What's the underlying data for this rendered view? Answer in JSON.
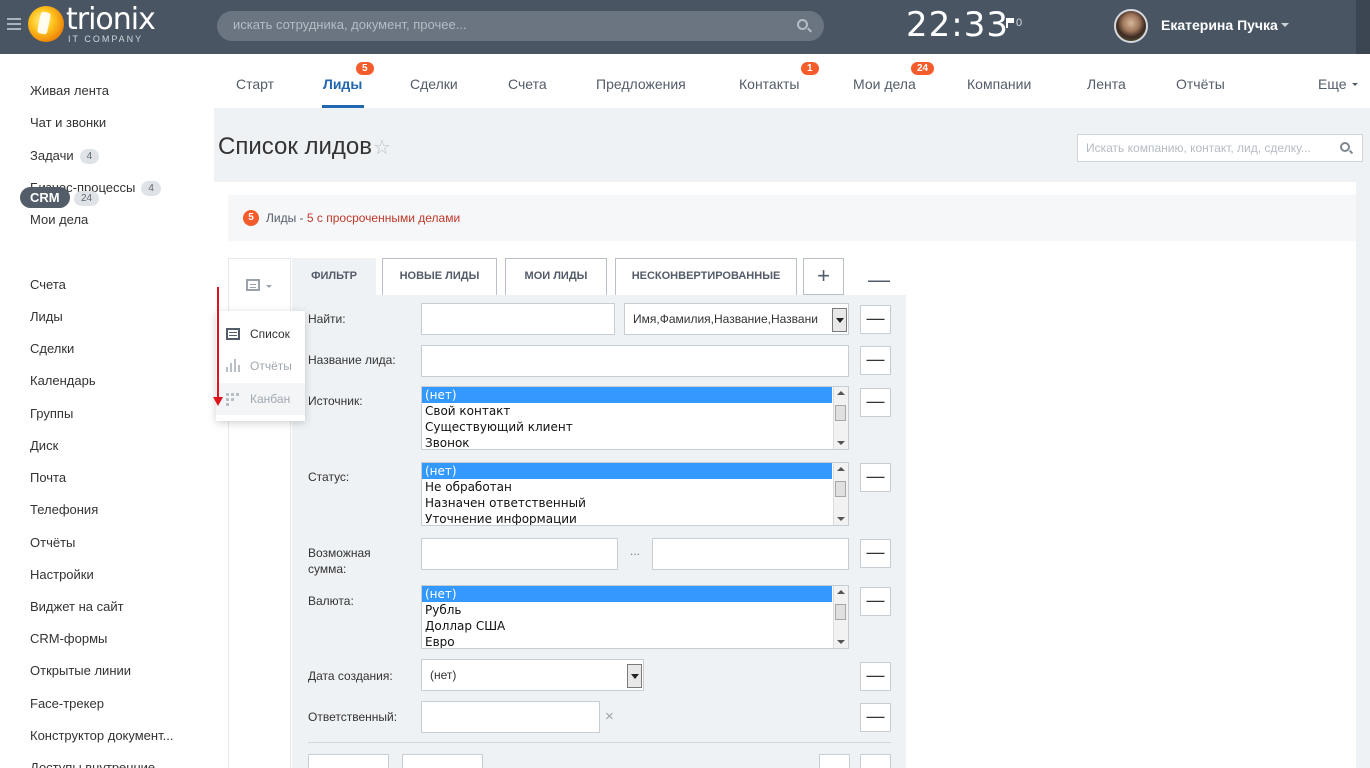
{
  "header": {
    "logo_text": "trionix",
    "logo_sub": "IT COMPANY",
    "search_placeholder": "искать сотрудника, документ, прочее...",
    "clock": "22:33",
    "flag_count": "0",
    "user_name": "Екатерина Пучка"
  },
  "left_menu": [
    {
      "label": "Живая лента"
    },
    {
      "label": "Чат и звонки"
    },
    {
      "label": "Задачи",
      "badge": "4"
    },
    {
      "label": "Бизнес-процессы",
      "badge": "4"
    },
    {
      "label": "Мои дела"
    },
    {
      "label": "CRM",
      "badge": "24"
    },
    {
      "label": "Счета"
    },
    {
      "label": "Лиды"
    },
    {
      "label": "Сделки"
    },
    {
      "label": "Календарь"
    },
    {
      "label": "Группы"
    },
    {
      "label": "Диск"
    },
    {
      "label": "Почта"
    },
    {
      "label": "Телефония"
    },
    {
      "label": "Отчёты"
    },
    {
      "label": "Настройки"
    },
    {
      "label": "Виджет на сайт"
    },
    {
      "label": "CRM-формы"
    },
    {
      "label": "Открытые линии"
    },
    {
      "label": "Face-трекер"
    },
    {
      "label": "Конструктор документ..."
    },
    {
      "label": "Доступы внутренние"
    }
  ],
  "tabs": [
    {
      "label": "Старт"
    },
    {
      "label": "Лиды",
      "badge": "5"
    },
    {
      "label": "Сделки"
    },
    {
      "label": "Счета"
    },
    {
      "label": "Предложения"
    },
    {
      "label": "Контакты",
      "badge": "1"
    },
    {
      "label": "Мои дела",
      "badge": "24"
    },
    {
      "label": "Компании"
    },
    {
      "label": "Лента"
    },
    {
      "label": "Отчёты"
    },
    {
      "label": "Еще"
    }
  ],
  "page": {
    "title": "Список лидов",
    "star": "☆",
    "crm_search_placeholder": "Искать компанию, контакт, лид, сделку..."
  },
  "notice": {
    "count": "5",
    "text": "Лиды - ",
    "link": "5 с просроченными делами"
  },
  "view_menu": {
    "items": [
      "Список",
      "Отчёты",
      "Канбан"
    ]
  },
  "filter_tabs": {
    "filter": "ФИЛЬТР",
    "presets": [
      "НОВЫЕ ЛИДЫ",
      "МОИ ЛИДЫ",
      "НЕСКОНВЕРТИРОВАННЫЕ"
    ],
    "add": "+",
    "collapse": "—"
  },
  "filter": {
    "find_label": "Найти:",
    "find_value": "",
    "find_scope": "Имя,Фамилия,Название,Названи",
    "name_label": "Название лида:",
    "source_label": "Источник:",
    "source_options": [
      "(нет)",
      "Свой контакт",
      "Существующий клиент",
      "Звонок"
    ],
    "status_label": "Статус:",
    "status_options": [
      "(нет)",
      "Не обработан",
      "Назначен ответственный",
      "Уточнение информации"
    ],
    "amount_label": "Возможная сумма:",
    "range_sep": "...",
    "currency_label": "Валюта:",
    "currency_options": [
      "(нет)",
      "Рубль",
      "Доллар США",
      "Евро"
    ],
    "date_label": "Дата создания:",
    "date_value": "(нет)",
    "responsible_label": "Ответственный:",
    "clear": "×",
    "minus": "—"
  }
}
